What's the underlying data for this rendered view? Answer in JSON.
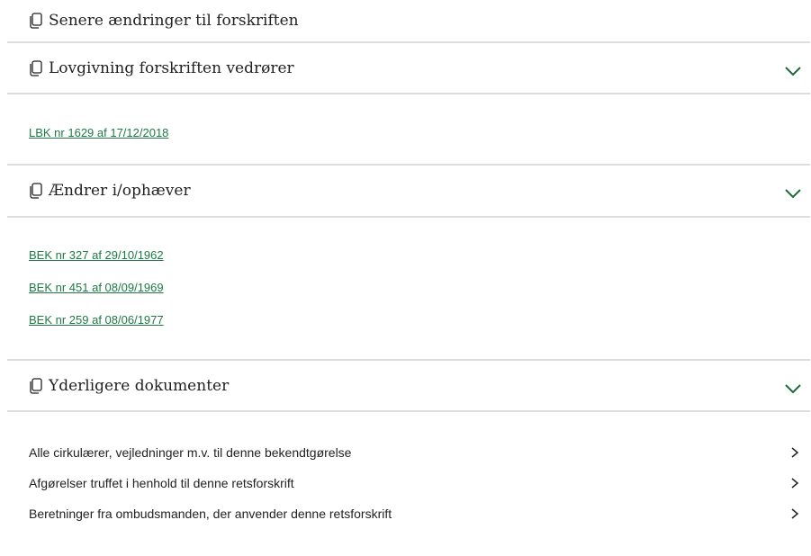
{
  "sections": {
    "senere": {
      "title": "Senere ændringer til forskriften"
    },
    "lovgivning": {
      "title": "Lovgivning forskriften vedrører",
      "links": [
        "LBK nr 1629 af 17/12/2018"
      ]
    },
    "aendrer": {
      "title": "Ændrer i/ophæver",
      "links": [
        "BEK nr 327 af 29/10/1962",
        "BEK nr 451 af 08/09/1969",
        "BEK nr 259 af 08/06/1977"
      ]
    },
    "yderligere": {
      "title": "Yderligere dokumenter",
      "items": [
        "Alle cirkulærer, vejledninger m.v. til denne bekendtgørelse",
        "Afgørelser truffet i henhold til denne retsforskrift",
        "Beretninger fra ombudsmanden, der anvender denne retsforskrift"
      ]
    }
  },
  "icons": {
    "section": "copy-icon",
    "expand": "chevron-down-icon",
    "navigate": "chevron-right-icon"
  },
  "colors": {
    "link": "#1e7a45",
    "chevron": "#1e6b3a",
    "divider": "#dcdcdc",
    "text": "#222222"
  }
}
